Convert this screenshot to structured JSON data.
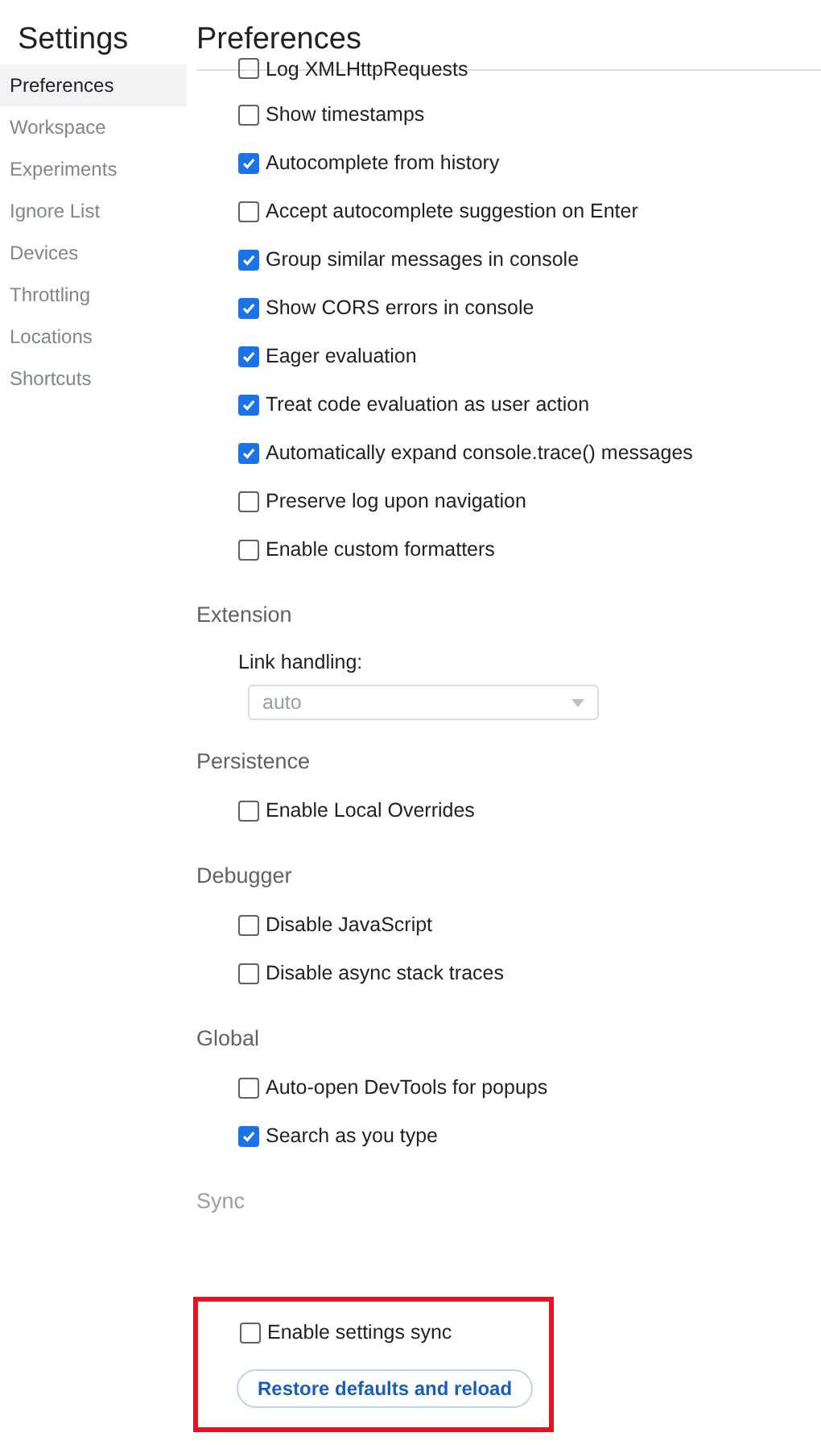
{
  "sidebar": {
    "title": "Settings",
    "items": [
      {
        "label": "Preferences",
        "selected": true
      },
      {
        "label": "Workspace",
        "selected": false
      },
      {
        "label": "Experiments",
        "selected": false
      },
      {
        "label": "Ignore List",
        "selected": false
      },
      {
        "label": "Devices",
        "selected": false
      },
      {
        "label": "Throttling",
        "selected": false
      },
      {
        "label": "Locations",
        "selected": false
      },
      {
        "label": "Shortcuts",
        "selected": false
      }
    ]
  },
  "main": {
    "title": "Preferences",
    "sections": [
      {
        "items": [
          {
            "kind": "checkbox",
            "label": "Log XMLHttpRequests",
            "checked": false
          },
          {
            "kind": "checkbox",
            "label": "Show timestamps",
            "checked": false
          },
          {
            "kind": "checkbox",
            "label": "Autocomplete from history",
            "checked": true
          },
          {
            "kind": "checkbox",
            "label": "Accept autocomplete suggestion on Enter",
            "checked": false
          },
          {
            "kind": "checkbox",
            "label": "Group similar messages in console",
            "checked": true
          },
          {
            "kind": "checkbox",
            "label": "Show CORS errors in console",
            "checked": true
          },
          {
            "kind": "checkbox",
            "label": "Eager evaluation",
            "checked": true
          },
          {
            "kind": "checkbox",
            "label": "Treat code evaluation as user action",
            "checked": true
          },
          {
            "kind": "checkbox",
            "label": "Automatically expand console.trace() messages",
            "checked": true
          },
          {
            "kind": "checkbox",
            "label": "Preserve log upon navigation",
            "checked": false
          },
          {
            "kind": "checkbox",
            "label": "Enable custom formatters",
            "checked": false
          }
        ]
      },
      {
        "heading": "Extension",
        "items": [
          {
            "kind": "select",
            "label": "Link handling:",
            "value": "auto",
            "disabled": true
          }
        ]
      },
      {
        "heading": "Persistence",
        "items": [
          {
            "kind": "checkbox",
            "label": "Enable Local Overrides",
            "checked": false
          }
        ]
      },
      {
        "heading": "Debugger",
        "items": [
          {
            "kind": "checkbox",
            "label": "Disable JavaScript",
            "checked": false
          },
          {
            "kind": "checkbox",
            "label": "Disable async stack traces",
            "checked": false
          }
        ]
      },
      {
        "heading": "Global",
        "items": [
          {
            "kind": "checkbox",
            "label": "Auto-open DevTools for popups",
            "checked": false
          },
          {
            "kind": "checkbox",
            "label": "Search as you type",
            "checked": true
          }
        ]
      },
      {
        "heading": "Sync",
        "disabled": true,
        "highlighted": true,
        "items": [
          {
            "kind": "checkbox",
            "label": "Enable settings sync",
            "checked": false
          },
          {
            "kind": "button",
            "label": "Restore defaults and reload"
          }
        ]
      }
    ]
  }
}
